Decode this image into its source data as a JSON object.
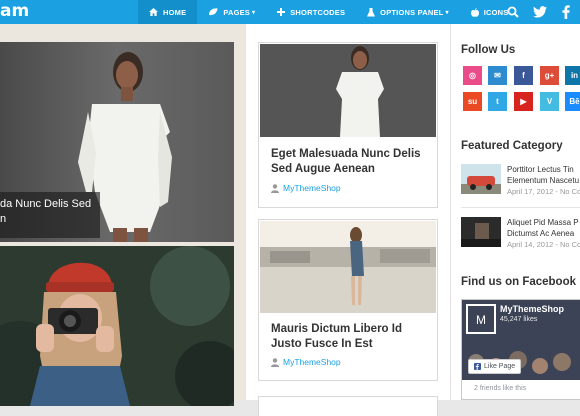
{
  "header": {
    "logo_text": "am",
    "nav": [
      {
        "label": "HOME",
        "icon": "home-icon",
        "active": true
      },
      {
        "label": "PAGES",
        "icon": "leaf-icon",
        "dropdown": true
      },
      {
        "label": "SHORTCODES",
        "icon": "plus-icon"
      },
      {
        "label": "OPTIONS PANEL",
        "icon": "flask-icon",
        "dropdown": true
      },
      {
        "label": "ICONS",
        "icon": "apple-icon"
      }
    ],
    "nav_caret": "▾",
    "tools": [
      "search-icon",
      "twitter-icon",
      "facebook-icon"
    ],
    "colors": {
      "accent": "#1ba1e2",
      "active": "#1390cc"
    }
  },
  "featured": {
    "caption_line1": "da Nunc Delis Sed",
    "caption_line2": "n",
    "slide_count": 2,
    "active_slide": 2
  },
  "posts": [
    {
      "title": "Eget Malesuada Nunc Delis Sed Augue Aenean",
      "author": "MyThemeShop"
    },
    {
      "title": "Mauris Dictum Libero Id Justo Fusce In Est",
      "author": "MyThemeShop"
    }
  ],
  "sidebar": {
    "follow_title": "Follow Us",
    "social": [
      {
        "name": "dribbble",
        "color": "#ea4c89",
        "glyph": "◎"
      },
      {
        "name": "email",
        "color": "#2d8ccf",
        "glyph": "✉"
      },
      {
        "name": "facebook",
        "color": "#3b5998",
        "glyph": "f"
      },
      {
        "name": "google-plus",
        "color": "#dd4b39",
        "glyph": "g+"
      },
      {
        "name": "linkedin",
        "color": "#0e76a8",
        "glyph": "in"
      },
      {
        "name": "stumbleupon",
        "color": "#eb4924",
        "glyph": "su"
      },
      {
        "name": "twitter",
        "color": "#2fa8e5",
        "glyph": "t"
      },
      {
        "name": "youtube",
        "color": "#d8241f",
        "glyph": "▶"
      },
      {
        "name": "vimeo",
        "color": "#44bbe0",
        "glyph": "V"
      },
      {
        "name": "behance",
        "color": "#1a8cff",
        "glyph": "Bē"
      }
    ],
    "featured_title": "Featured Category",
    "featured_items": [
      {
        "title_line1": "Porttitor Lectus Tin",
        "title_line2": "Elementum Nascetu",
        "date": "April 17, 2012 - No Co"
      },
      {
        "title_line1": "Aliquet Pid Massa P",
        "title_line2": "Dictumst Ac Aenea",
        "date": "April 14, 2012 - No Co"
      }
    ],
    "facebook_title": "Find us on Facebook",
    "facebook_page": "MyThemeShop",
    "facebook_likes": "45,247 likes",
    "facebook_like_button": "Like Page",
    "facebook_friends": "2 friends like this"
  }
}
